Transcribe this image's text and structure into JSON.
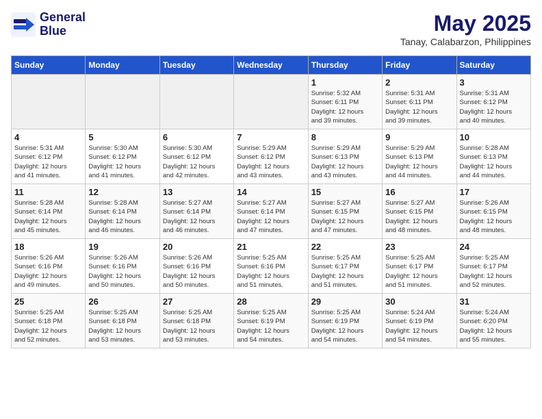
{
  "logo": {
    "line1": "General",
    "line2": "Blue"
  },
  "title": "May 2025",
  "subtitle": "Tanay, Calabarzon, Philippines",
  "weekdays": [
    "Sunday",
    "Monday",
    "Tuesday",
    "Wednesday",
    "Thursday",
    "Friday",
    "Saturday"
  ],
  "weeks": [
    [
      {
        "day": "",
        "info": ""
      },
      {
        "day": "",
        "info": ""
      },
      {
        "day": "",
        "info": ""
      },
      {
        "day": "",
        "info": ""
      },
      {
        "day": "1",
        "info": "Sunrise: 5:32 AM\nSunset: 6:11 PM\nDaylight: 12 hours\nand 39 minutes."
      },
      {
        "day": "2",
        "info": "Sunrise: 5:31 AM\nSunset: 6:11 PM\nDaylight: 12 hours\nand 39 minutes."
      },
      {
        "day": "3",
        "info": "Sunrise: 5:31 AM\nSunset: 6:12 PM\nDaylight: 12 hours\nand 40 minutes."
      }
    ],
    [
      {
        "day": "4",
        "info": "Sunrise: 5:31 AM\nSunset: 6:12 PM\nDaylight: 12 hours\nand 41 minutes."
      },
      {
        "day": "5",
        "info": "Sunrise: 5:30 AM\nSunset: 6:12 PM\nDaylight: 12 hours\nand 41 minutes."
      },
      {
        "day": "6",
        "info": "Sunrise: 5:30 AM\nSunset: 6:12 PM\nDaylight: 12 hours\nand 42 minutes."
      },
      {
        "day": "7",
        "info": "Sunrise: 5:29 AM\nSunset: 6:12 PM\nDaylight: 12 hours\nand 43 minutes."
      },
      {
        "day": "8",
        "info": "Sunrise: 5:29 AM\nSunset: 6:13 PM\nDaylight: 12 hours\nand 43 minutes."
      },
      {
        "day": "9",
        "info": "Sunrise: 5:29 AM\nSunset: 6:13 PM\nDaylight: 12 hours\nand 44 minutes."
      },
      {
        "day": "10",
        "info": "Sunrise: 5:28 AM\nSunset: 6:13 PM\nDaylight: 12 hours\nand 44 minutes."
      }
    ],
    [
      {
        "day": "11",
        "info": "Sunrise: 5:28 AM\nSunset: 6:14 PM\nDaylight: 12 hours\nand 45 minutes."
      },
      {
        "day": "12",
        "info": "Sunrise: 5:28 AM\nSunset: 6:14 PM\nDaylight: 12 hours\nand 46 minutes."
      },
      {
        "day": "13",
        "info": "Sunrise: 5:27 AM\nSunset: 6:14 PM\nDaylight: 12 hours\nand 46 minutes."
      },
      {
        "day": "14",
        "info": "Sunrise: 5:27 AM\nSunset: 6:14 PM\nDaylight: 12 hours\nand 47 minutes."
      },
      {
        "day": "15",
        "info": "Sunrise: 5:27 AM\nSunset: 6:15 PM\nDaylight: 12 hours\nand 47 minutes."
      },
      {
        "day": "16",
        "info": "Sunrise: 5:27 AM\nSunset: 6:15 PM\nDaylight: 12 hours\nand 48 minutes."
      },
      {
        "day": "17",
        "info": "Sunrise: 5:26 AM\nSunset: 6:15 PM\nDaylight: 12 hours\nand 48 minutes."
      }
    ],
    [
      {
        "day": "18",
        "info": "Sunrise: 5:26 AM\nSunset: 6:16 PM\nDaylight: 12 hours\nand 49 minutes."
      },
      {
        "day": "19",
        "info": "Sunrise: 5:26 AM\nSunset: 6:16 PM\nDaylight: 12 hours\nand 50 minutes."
      },
      {
        "day": "20",
        "info": "Sunrise: 5:26 AM\nSunset: 6:16 PM\nDaylight: 12 hours\nand 50 minutes."
      },
      {
        "day": "21",
        "info": "Sunrise: 5:25 AM\nSunset: 6:16 PM\nDaylight: 12 hours\nand 51 minutes."
      },
      {
        "day": "22",
        "info": "Sunrise: 5:25 AM\nSunset: 6:17 PM\nDaylight: 12 hours\nand 51 minutes."
      },
      {
        "day": "23",
        "info": "Sunrise: 5:25 AM\nSunset: 6:17 PM\nDaylight: 12 hours\nand 51 minutes."
      },
      {
        "day": "24",
        "info": "Sunrise: 5:25 AM\nSunset: 6:17 PM\nDaylight: 12 hours\nand 52 minutes."
      }
    ],
    [
      {
        "day": "25",
        "info": "Sunrise: 5:25 AM\nSunset: 6:18 PM\nDaylight: 12 hours\nand 52 minutes."
      },
      {
        "day": "26",
        "info": "Sunrise: 5:25 AM\nSunset: 6:18 PM\nDaylight: 12 hours\nand 53 minutes."
      },
      {
        "day": "27",
        "info": "Sunrise: 5:25 AM\nSunset: 6:18 PM\nDaylight: 12 hours\nand 53 minutes."
      },
      {
        "day": "28",
        "info": "Sunrise: 5:25 AM\nSunset: 6:19 PM\nDaylight: 12 hours\nand 54 minutes."
      },
      {
        "day": "29",
        "info": "Sunrise: 5:25 AM\nSunset: 6:19 PM\nDaylight: 12 hours\nand 54 minutes."
      },
      {
        "day": "30",
        "info": "Sunrise: 5:24 AM\nSunset: 6:19 PM\nDaylight: 12 hours\nand 54 minutes."
      },
      {
        "day": "31",
        "info": "Sunrise: 5:24 AM\nSunset: 6:20 PM\nDaylight: 12 hours\nand 55 minutes."
      }
    ]
  ]
}
